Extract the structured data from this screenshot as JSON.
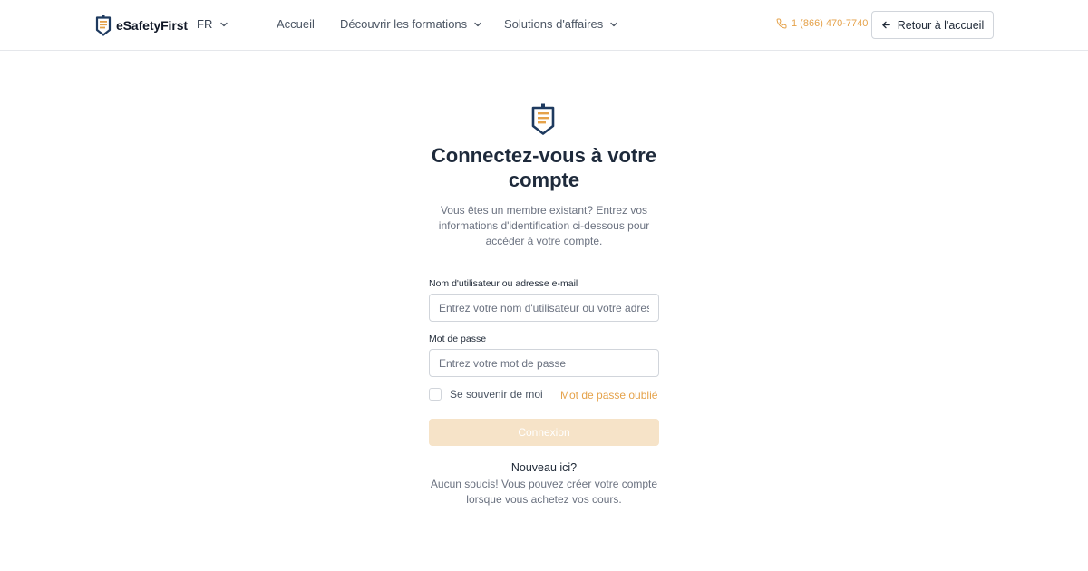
{
  "header": {
    "brand": "eSafetyFirst",
    "language": "FR",
    "nav": {
      "home": "Accueil",
      "courses": "Découvrir les formations",
      "business": "Solutions d'affaires"
    },
    "phone": "1 (866) 470-7740",
    "back_label": "Retour à l'accueil"
  },
  "login": {
    "title": "Connectez-vous à votre compte",
    "subtitle": "Vous êtes un membre existant? Entrez vos informations d'identification ci-dessous pour accéder à votre compte.",
    "username_label": "Nom d'utilisateur ou adresse e-mail",
    "username_placeholder": "Entrez votre nom d'utilisateur ou votre adresse e-mail",
    "password_label": "Mot de passe",
    "password_placeholder": "Entrez votre mot de passe",
    "remember_label": "Se souvenir de moi",
    "forgot_label": "Mot de passe oublié",
    "submit_label": "Connexion",
    "new_title": "Nouveau ici?",
    "new_text": "Aucun soucis! Vous pouvez créer votre compte lorsque vous achetez vos cours."
  },
  "icons": {
    "logo": "shield-document-icon",
    "language_chevron": "chevron-down-icon",
    "phone": "phone-icon",
    "back": "arrow-left-icon"
  },
  "colors": {
    "accent": "#e5a24a",
    "navy": "#1e3a5f",
    "button_disabled": "#f6e3c8"
  }
}
